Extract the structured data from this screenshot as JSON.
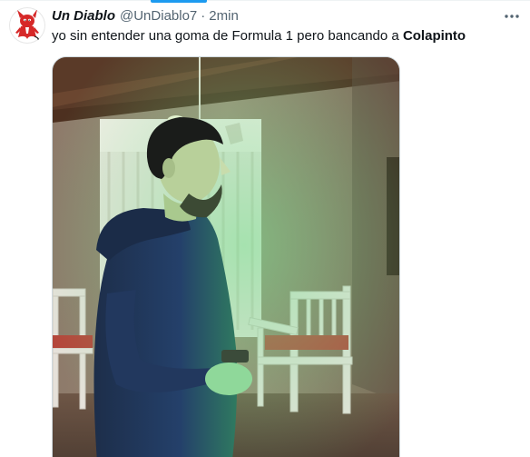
{
  "tweet": {
    "display_name": "Un Diablo",
    "handle": "@UnDiablo7",
    "separator": "·",
    "timestamp": "2min",
    "text_prefix": "yo sin entender una goma de Formula 1 pero bancando a ",
    "text_bold": "Colapinto",
    "media": {
      "kind": "photo",
      "subject": "man-in-blue-hoodie-green-light"
    }
  },
  "icons": {
    "avatar": "red-devil-avatar",
    "more": "more-dots-icon"
  },
  "colors": {
    "text_primary": "#0f1419",
    "text_secondary": "#536471",
    "accent": "#1d9bf0",
    "avatar_red": "#d62828"
  }
}
